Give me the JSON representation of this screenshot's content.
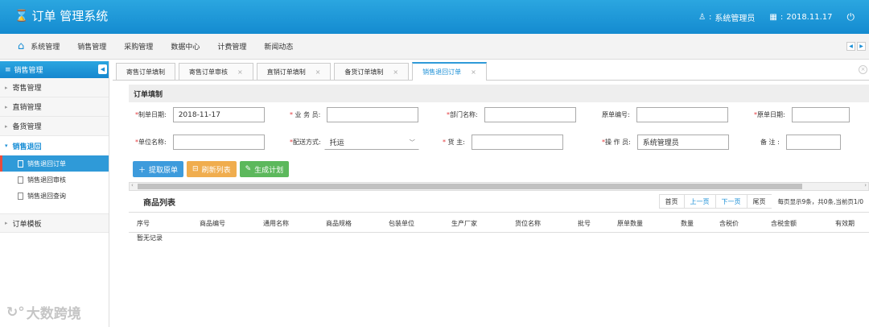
{
  "app": {
    "title": "订单 管理系统"
  },
  "header": {
    "user": "系统管理员",
    "date": "2018.11.17"
  },
  "topnav": [
    "系统管理",
    "销售管理",
    "采购管理",
    "数据中心",
    "计费管理",
    "新闻动态"
  ],
  "sidebar": {
    "title": "销售管理",
    "items": [
      {
        "label": "寄售管理"
      },
      {
        "label": "直销管理"
      },
      {
        "label": "备货管理"
      },
      {
        "label": "销售退回"
      }
    ],
    "subitems": [
      {
        "label": "销售退回订单"
      },
      {
        "label": "销售退回审核"
      },
      {
        "label": "销售退回查询"
      }
    ],
    "extra": {
      "label": "订单模板"
    }
  },
  "tabs": [
    {
      "label": "寄售订单填制"
    },
    {
      "label": "寄售订单审核"
    },
    {
      "label": "直销订单填制"
    },
    {
      "label": "备货订单填制"
    },
    {
      "label": "销售退回订单"
    }
  ],
  "form": {
    "section_title": "订单填制",
    "fields": {
      "order_date": {
        "label": "制单日期:",
        "value": "2018-11-17"
      },
      "salesman": {
        "label": "业 务 员:",
        "value": ""
      },
      "department": {
        "label": "部门名称:",
        "value": ""
      },
      "orig_no": {
        "label": "原单编号:",
        "value": ""
      },
      "orig_date": {
        "label": "原单日期:",
        "value": ""
      },
      "unit_name": {
        "label": "单位名称:",
        "value": ""
      },
      "delivery": {
        "label": "配送方式:",
        "value": "托运"
      },
      "owner": {
        "label": "货    主:",
        "value": ""
      },
      "operator": {
        "label": "操 作 员:",
        "value": "系统管理员"
      },
      "remark": {
        "label": "备    注 :",
        "value": ""
      }
    }
  },
  "buttons": {
    "fetch": "提取原单",
    "refresh": "刷新列表",
    "generate": "生成计划"
  },
  "list": {
    "title": "商品列表",
    "pager": {
      "first": "首页",
      "prev": "上一页",
      "next": "下一页",
      "last": "尾页",
      "info": "每页显示9条，共0条,当前页1/0"
    },
    "columns": [
      "序号",
      "商品编号",
      "通用名称",
      "商品规格",
      "包装单位",
      "生产厂家",
      "货位名称",
      "批号",
      "原单数量",
      "数量",
      "含税价",
      "含税金额",
      "有效期"
    ],
    "empty_text": "暂无记录"
  },
  "watermark": "大数跨境"
}
